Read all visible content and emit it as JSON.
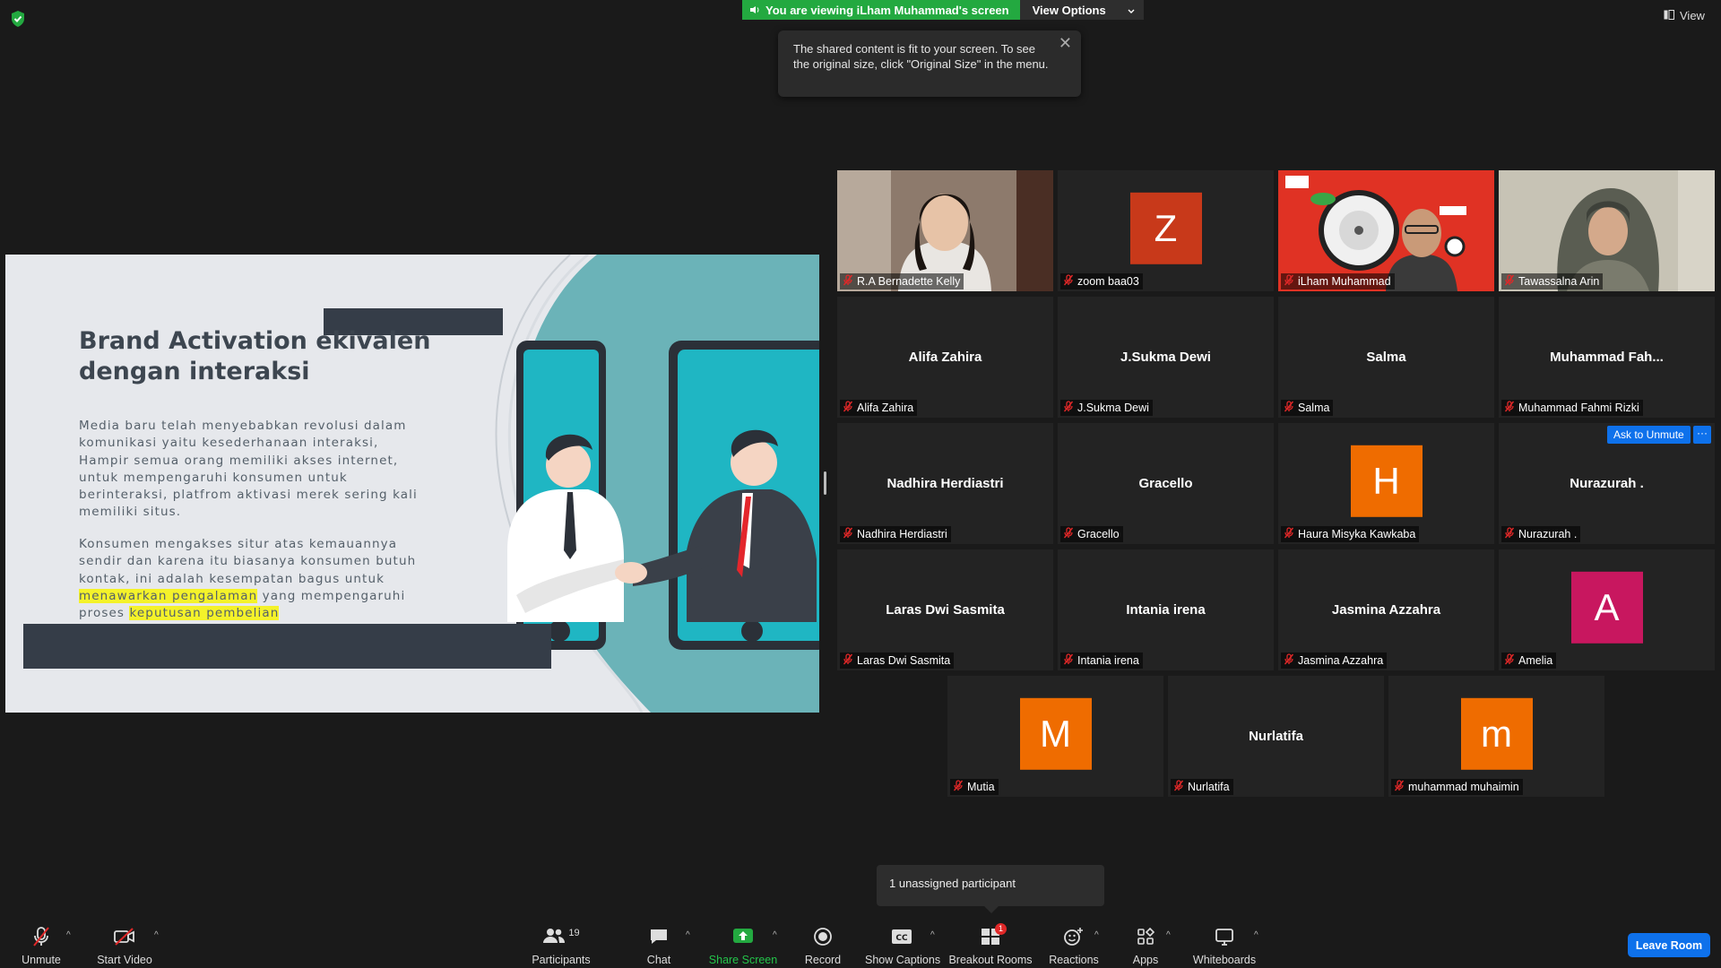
{
  "top": {
    "viewing_text": "You are viewing iLham Muhammad's screen",
    "view_options": "View Options",
    "view": "View"
  },
  "toast": {
    "text": "The shared content is fit to your screen. To see the original size, click \"Original Size\" in the menu."
  },
  "slide": {
    "title": "Brand Activation ekivalen dengan interaksi",
    "p1": "Media baru telah menyebabkan revolusi dalam komunikasi yaitu kesederhanaan interaksi, Hampir semua orang memiliki akses internet, untuk mempengaruhi konsumen untuk berinteraksi, platfrom aktivasi merek sering kali memiliki situs.",
    "p2_a": "Konsumen mengakses situr atas kemauannya sendir dan karena itu biasanya konsumen butuh kontak, ini adalah kesempatan bagus untuk ",
    "p2_hl1": "menawarkan pengalaman",
    "p2_b": " yang mempengaruhi proses ",
    "p2_hl2": "keputusan pembelian"
  },
  "participants": [
    {
      "name": "R.A Bernadette Kelly",
      "type": "video"
    },
    {
      "name": "zoom baa03",
      "type": "avatar",
      "initial": "Z",
      "color": "#c8391a"
    },
    {
      "name": "iLham Muhammad",
      "type": "video",
      "active": true
    },
    {
      "name": "Tawassalna Arin",
      "type": "video"
    },
    {
      "name": "Alifa Zahira",
      "display": "Alifa Zahira",
      "type": "name"
    },
    {
      "name": "J.Sukma Dewi",
      "display": "J.Sukma Dewi",
      "type": "name"
    },
    {
      "name": "Salma",
      "display": "Salma",
      "type": "name"
    },
    {
      "name": "Muhammad Fahmi Rizki",
      "display": "Muhammad  Fah...",
      "type": "name"
    },
    {
      "name": "Nadhira Herdiastri",
      "display": "Nadhira Herdiastri",
      "type": "name"
    },
    {
      "name": "Gracello",
      "display": "Gracello",
      "type": "name"
    },
    {
      "name": "Haura Misyka Kawkaba",
      "type": "avatar",
      "initial": "H",
      "color": "#ef6c00"
    },
    {
      "name": "Nurazurah .",
      "display": "Nurazurah .",
      "type": "name"
    },
    {
      "name": "Laras Dwi Sasmita",
      "display": "Laras Dwi Sasmita",
      "type": "name"
    },
    {
      "name": "Intania irena",
      "display": "Intania irena",
      "type": "name"
    },
    {
      "name": "Jasmina Azzahra",
      "display": "Jasmina Azzahra",
      "type": "name"
    },
    {
      "name": "Amelia",
      "type": "avatar",
      "initial": "A",
      "color": "#c8175f"
    },
    {
      "name": "Mutia",
      "type": "avatar",
      "initial": "M",
      "color": "#ef6c00"
    },
    {
      "name": "Nurlatifa",
      "display": "Nurlatifa",
      "type": "name"
    },
    {
      "name": "muhammad muhaimin",
      "type": "avatar",
      "initial": "m",
      "color": "#ef6c00"
    }
  ],
  "tile_actions": {
    "ask_to_unmute": "Ask to Unmute",
    "more": "···"
  },
  "unassigned": "1 unassigned participant",
  "toolbar": {
    "unmute": "Unmute",
    "start_video": "Start Video",
    "participants": "Participants",
    "participants_count": "19",
    "chat": "Chat",
    "share_screen": "Share Screen",
    "record": "Record",
    "show_captions": "Show Captions",
    "breakout_rooms": "Breakout Rooms",
    "breakout_badge": "1",
    "reactions": "Reactions",
    "apps": "Apps",
    "whiteboards": "Whiteboards",
    "leave": "Leave Room"
  },
  "colors": {
    "accent_green": "#23a940",
    "accent_blue": "#0e71eb",
    "active_border": "#f3e46e",
    "muted_red": "#e02828"
  }
}
